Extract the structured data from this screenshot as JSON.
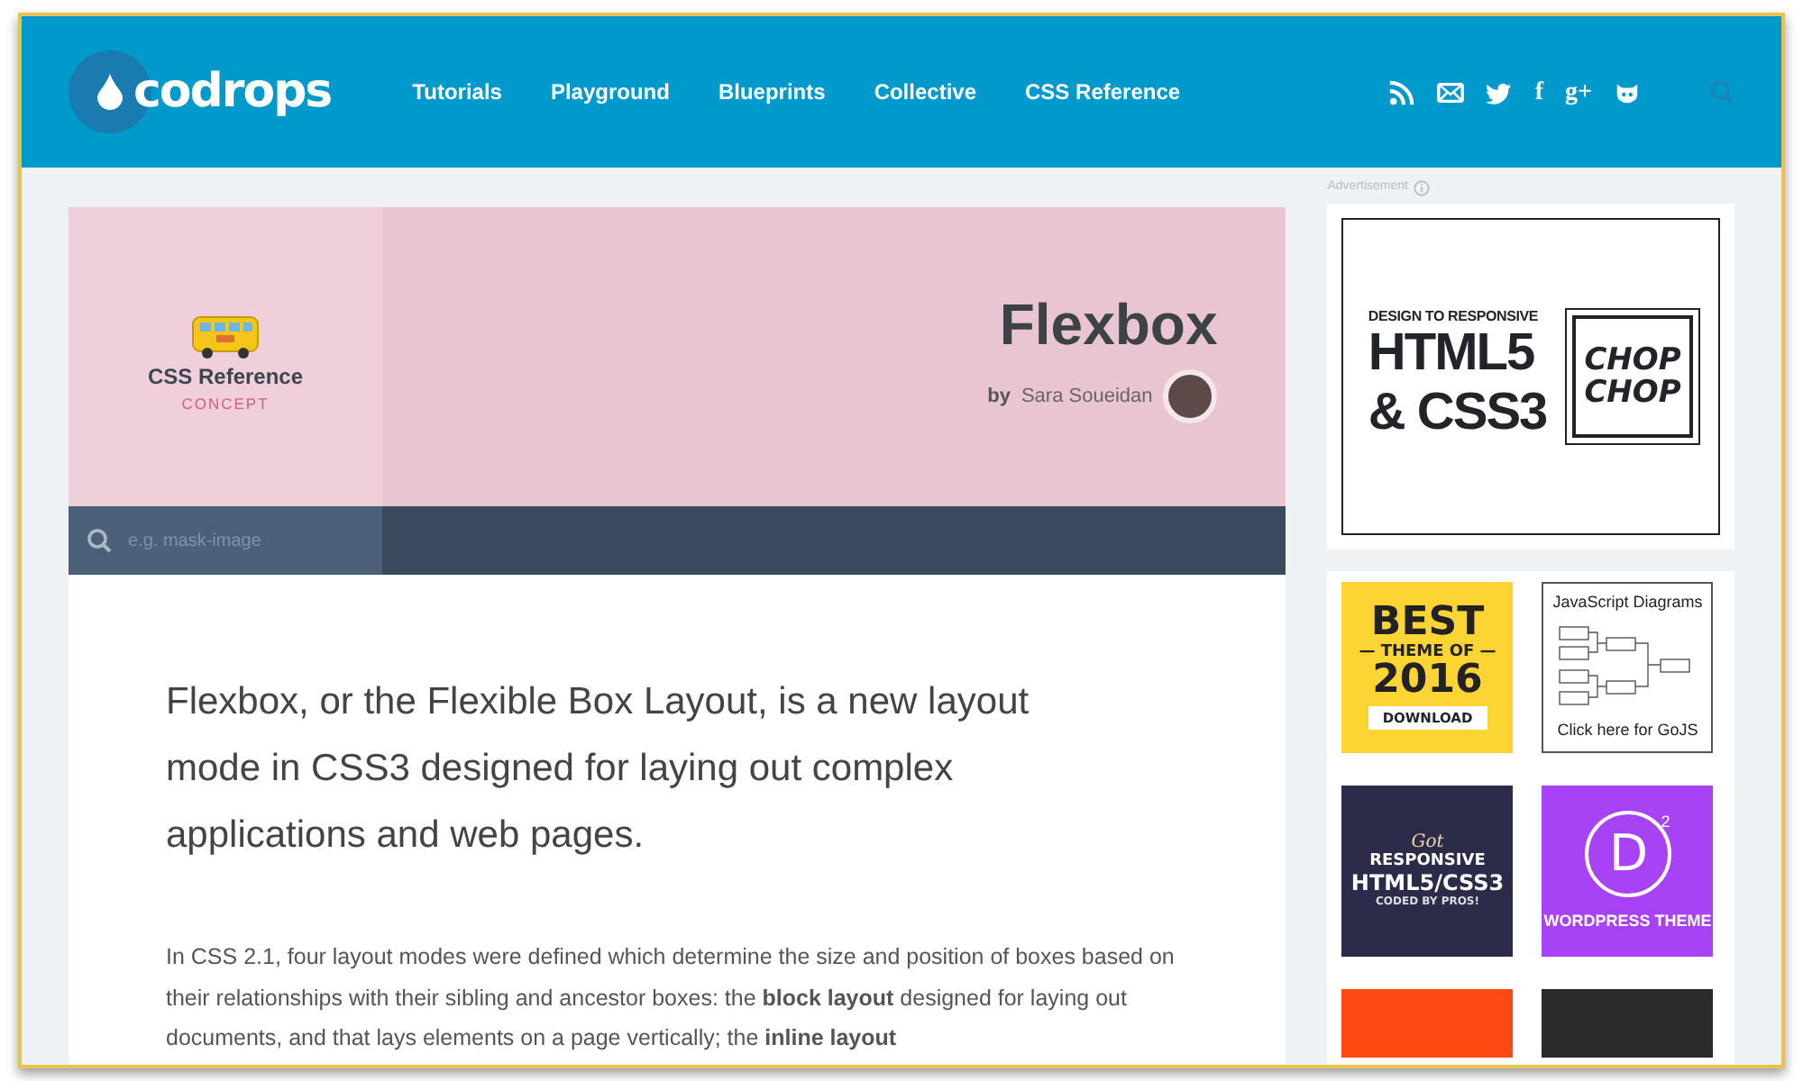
{
  "header": {
    "logo": "codrops",
    "nav": [
      {
        "label": "Tutorials"
      },
      {
        "label": "Playground"
      },
      {
        "label": "Blueprints"
      },
      {
        "label": "Collective"
      },
      {
        "label": "CSS Reference"
      }
    ],
    "social": [
      {
        "kind": "rss"
      },
      {
        "kind": "mail"
      },
      {
        "kind": "twitter"
      },
      {
        "kind": "text",
        "label": "f"
      },
      {
        "kind": "text",
        "label": "g+"
      },
      {
        "kind": "cat"
      }
    ]
  },
  "hero": {
    "section": "CSS Reference",
    "category": "CONCEPT",
    "title": "Flexbox",
    "by": "by",
    "author": "Sara Soueidan",
    "search": {
      "placeholder": "e.g. mask-image"
    }
  },
  "article": {
    "lead": "Flexbox, or the Flexible Box Layout, is a new layout mode in CSS3 designed for laying out complex applications and web pages.",
    "paragraph": "In CSS 2.1, four layout modes were defined which determine the size and position of boxes based on their relationships with their sibling and ancestor boxes: the **block layout** designed for laying out documents, and that lays elements on a page vertically; the **inline layout**"
  },
  "sidebar": {
    "label": "Advertisement",
    "ads": [
      {
        "kind": "chop",
        "color": "#ffffff",
        "lines": [
          "DESIGN TO RESPONSIVE",
          "HTML5",
          "& CSS3",
          "CHOP",
          "CHOP"
        ]
      },
      {
        "kind": "best",
        "color": "#fcd535",
        "lines": [
          "BEST",
          "— THEME OF —",
          "2016",
          "DOWNLOAD"
        ]
      },
      {
        "kind": "gojs",
        "color": "#ffffff",
        "lines": [
          "JavaScript Diagrams",
          "Click here for GoJS"
        ]
      },
      {
        "kind": "pros",
        "color": "#2c2b4a",
        "lines": [
          "Got",
          "RESPONSIVE",
          "HTML5/CSS3",
          "CODED BY PROS!"
        ]
      },
      {
        "kind": "divi",
        "color": "#a842f5",
        "lines": [
          "D",
          "2",
          "WORDPRESS THEME"
        ]
      },
      {
        "kind": "blank",
        "color": "#fc4a12"
      },
      {
        "kind": "blank",
        "color": "#2a2a2a"
      }
    ]
  }
}
